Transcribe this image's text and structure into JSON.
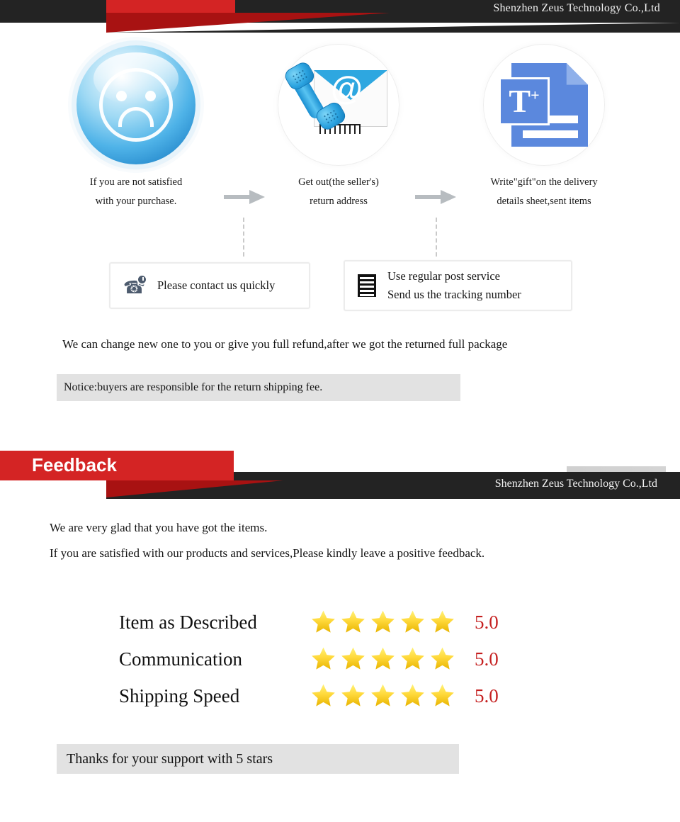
{
  "top_banner": {
    "company": "Shenzhen Zeus Technology Co.,Ltd",
    "accent_red": "#d42424",
    "accent_dark": "#232323"
  },
  "steps": [
    {
      "icon": "sad-face-icon",
      "caption_line1": "If you are not satisfied",
      "caption_line2": "with your purchase."
    },
    {
      "icon": "phone-envelope-icon",
      "caption_line1": "Get out(the seller's)",
      "caption_line2": "return address"
    },
    {
      "icon": "document-text-icon",
      "caption_line1": "Write\"gift\"on the delivery",
      "caption_line2": "details sheet,sent items"
    }
  ],
  "info_boxes": [
    {
      "icon": "phone-clock-icon",
      "line1": "Please contact us quickly",
      "line2": ""
    },
    {
      "icon": "list-document-icon",
      "line1": "Use regular post service",
      "line2": "Send us the tracking number"
    }
  ],
  "refund_text": "We can change new one to you or give you full refund,after we got the returned full package",
  "notice_text": "Notice:buyers are responsible for the return shipping fee.",
  "feedback_banner": {
    "title": "Feedback",
    "company": "Shenzhen Zeus Technology Co.,Ltd"
  },
  "feedback_text": {
    "line1": "We are very glad that you have got the items.",
    "line2": "If you are satisfied with our products and services,Please kindly leave a positive feedback."
  },
  "ratings": {
    "star_color": "#f5c518",
    "score_color": "#c52020",
    "rows": [
      {
        "label": "Item as Described",
        "stars": 5,
        "score": "5.0"
      },
      {
        "label": "Communication",
        "stars": 5,
        "score": "5.0"
      },
      {
        "label": "Shipping Speed",
        "stars": 5,
        "score": "5.0"
      }
    ]
  },
  "thanks_text": "Thanks for your support with 5 stars"
}
